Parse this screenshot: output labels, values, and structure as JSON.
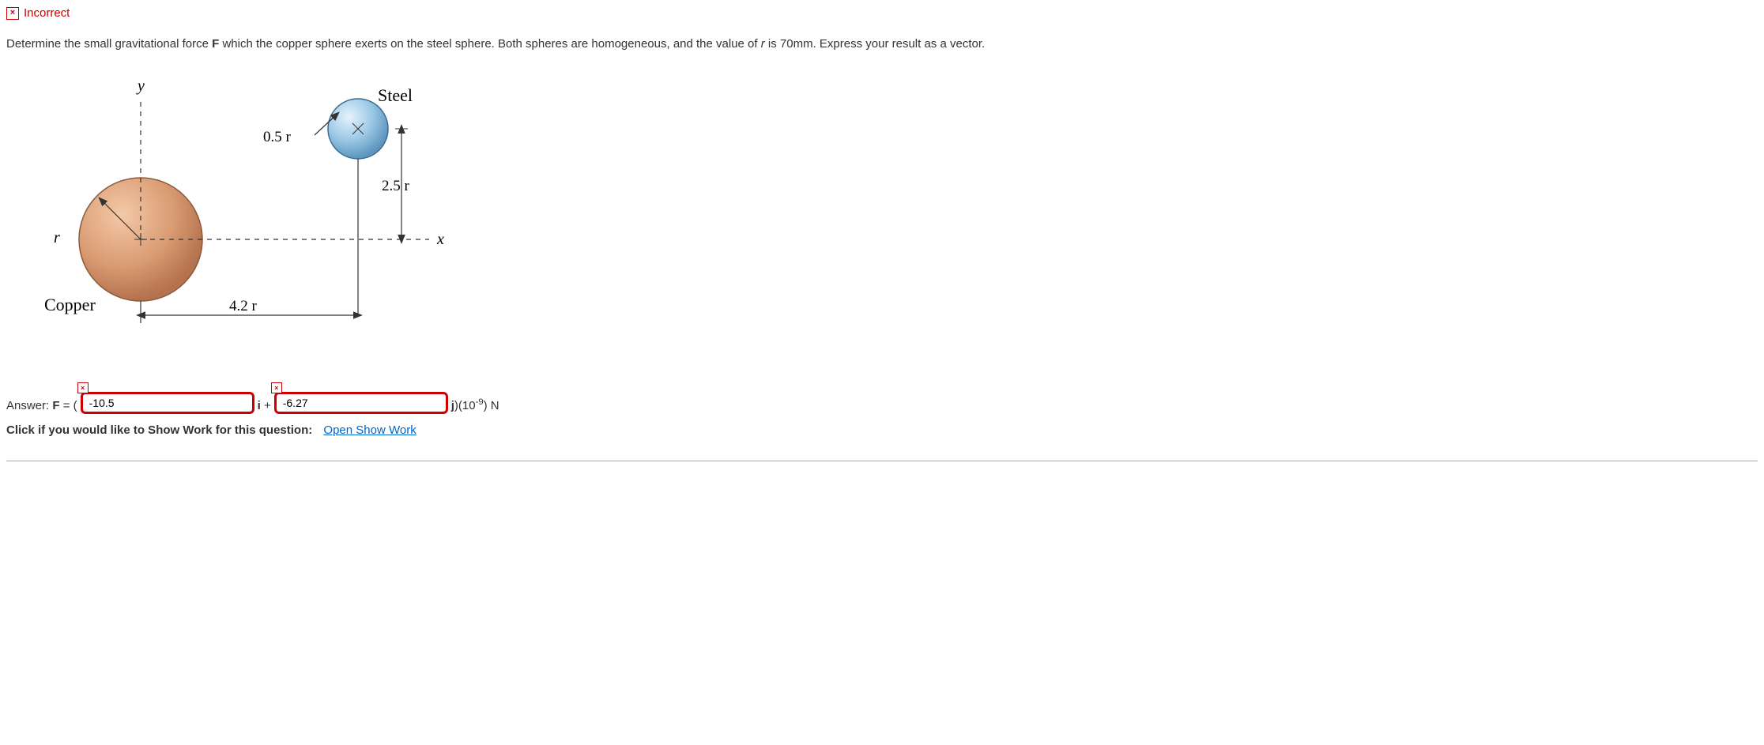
{
  "status": {
    "icon": "×",
    "text": "Incorrect"
  },
  "question": {
    "part1": "Determine the small gravitational force ",
    "bold1": "F",
    "part2": " which the copper sphere exerts on the steel sphere. Both spheres are homogeneous, and the value of ",
    "italic1": "r",
    "part3": " is 70mm. Express your result as a vector."
  },
  "diagram": {
    "y_label": "y",
    "x_label": "x",
    "r_label": "r",
    "copper_label": "Copper",
    "steel_label": "Steel",
    "dim_05r": "0.5 r",
    "dim_25r": "2.5 r",
    "dim_42r": "4.2 r"
  },
  "answer": {
    "prefix": "Answer: ",
    "F_label": "F",
    "equals": " = (",
    "input1_value": "-10.5",
    "mid1": "i",
    "plus": " + ",
    "input2_value": "-6.27",
    "mid2": "j",
    "suffix_open": ")(10",
    "suffix_exp": "-9",
    "suffix_close": ") N",
    "mark": "×"
  },
  "show_work": {
    "prompt": "Click if you would like to Show Work for this question:",
    "link": "Open Show Work"
  }
}
